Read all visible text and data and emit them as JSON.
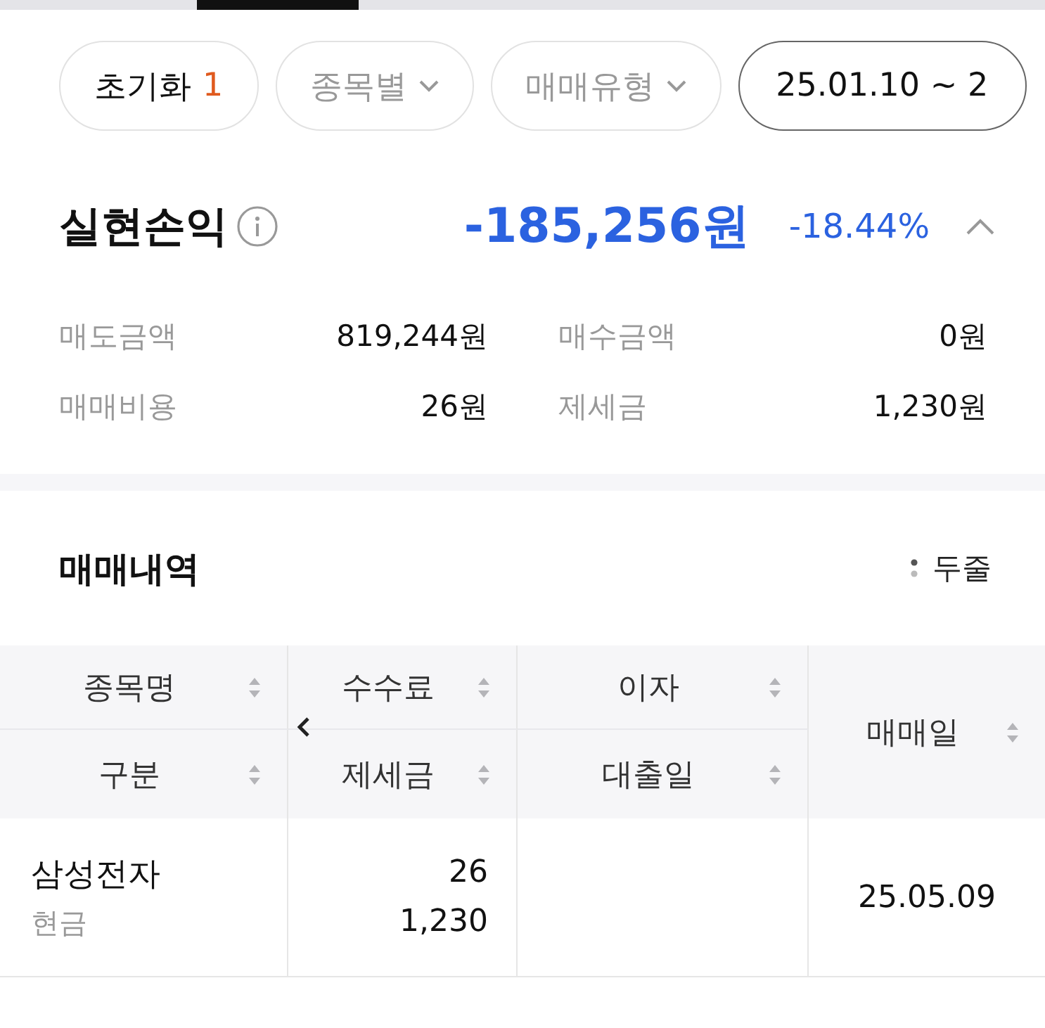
{
  "filters": [
    {
      "label": "초기화",
      "count": "1",
      "kind": "reset"
    },
    {
      "label": "종목별",
      "kind": "dropdown"
    },
    {
      "label": "매매유형",
      "kind": "dropdown"
    },
    {
      "label": "25.01.10 ~ 2",
      "kind": "date"
    }
  ],
  "summary": {
    "title": "실현손익",
    "amount": "-185,256원",
    "rate": "-18.44%",
    "expanded": true,
    "details": [
      {
        "label": "매도금액",
        "value": "819,244원"
      },
      {
        "label": "매수금액",
        "value": "0원"
      },
      {
        "label": "매매비용",
        "value": "26원"
      },
      {
        "label": "제세금",
        "value": "1,230원"
      }
    ]
  },
  "history": {
    "title": "매매내역",
    "view_option": "두줄",
    "columns": [
      {
        "top": "종목명",
        "bottom": "구분"
      },
      {
        "top": "수수료",
        "bottom": "제세금"
      },
      {
        "top": "이자",
        "bottom": "대출일"
      },
      {
        "top": "매매일"
      }
    ],
    "rows": [
      {
        "name": "삼성전자",
        "account_type": "현금",
        "fee": "26",
        "tax": "1,230",
        "trade_date": "25.05.09"
      }
    ]
  }
}
